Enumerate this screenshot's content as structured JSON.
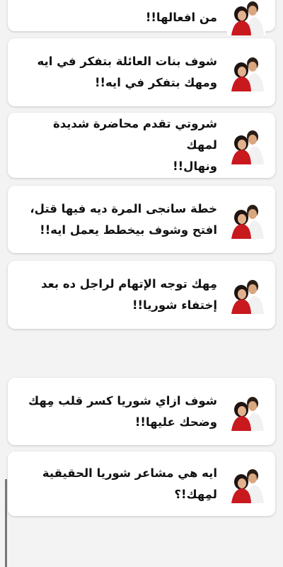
{
  "stories": [
    {
      "title": "من افعالها!!"
    },
    {
      "title": "شوف بنات العائلة بتفكر في ايه\nومهك بتفكر في ايه!!"
    },
    {
      "title": "شروتي تقدم محاضرة شديدة لمهك\nونهال!!"
    },
    {
      "title": "خطة سانجى المرة ديه فيها قتل،\nافتح وشوف بيخطط يعمل ايه!!"
    },
    {
      "title": "مِهك توجه الإتهام لراجل ده بعد\nإختفاء شوريا!!"
    },
    {
      "title": "شوف ازاي شوريا كسر قلب مِهك\nوضحك عليها!!"
    },
    {
      "title": "ايه هي مشاعر شوريا الحقيقية\nلمِهك!؟"
    }
  ],
  "colors": {
    "background": "#f3f3f3",
    "card": "#ffffff",
    "title_text": "#111111",
    "thumb_dress": "#c8191e"
  },
  "icons": {
    "thumbnail": "couple-thumbnail-icon"
  }
}
